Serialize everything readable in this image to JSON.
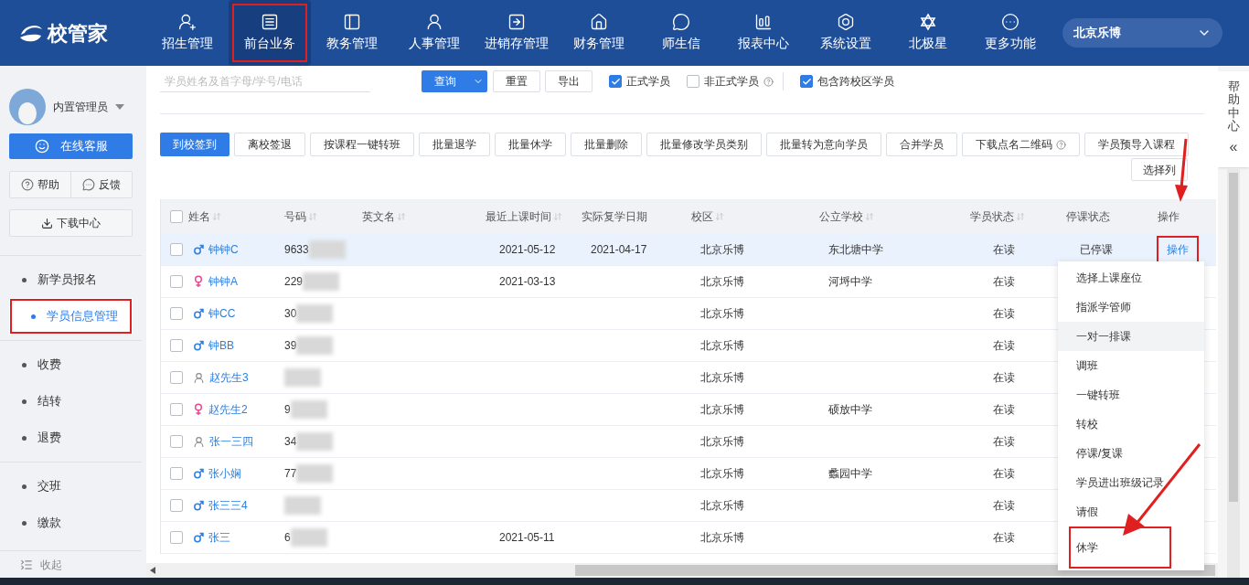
{
  "logo": {
    "text": "校管家"
  },
  "nav": [
    {
      "label": "招生管理",
      "selected": false,
      "highlighted": false
    },
    {
      "label": "前台业务",
      "selected": true,
      "highlighted": true
    },
    {
      "label": "教务管理",
      "selected": false,
      "highlighted": false
    },
    {
      "label": "人事管理",
      "selected": false,
      "highlighted": false
    },
    {
      "label": "进销存管理",
      "selected": false,
      "highlighted": false
    },
    {
      "label": "财务管理",
      "selected": false,
      "highlighted": false
    },
    {
      "label": "师生信",
      "selected": false,
      "highlighted": false
    },
    {
      "label": "报表中心",
      "selected": false,
      "highlighted": false
    },
    {
      "label": "系统设置",
      "selected": false,
      "highlighted": false
    },
    {
      "label": "北极星",
      "selected": false,
      "highlighted": false
    },
    {
      "label": "更多功能",
      "selected": false,
      "highlighted": false
    }
  ],
  "campus_select": {
    "value": "北京乐博"
  },
  "sidebar": {
    "user": "内置管理员",
    "service_button": "在线客服",
    "help": "帮助",
    "feedback": "反馈",
    "download": "下载中心",
    "menu_groups": [
      {
        "items": [
          {
            "label": "新学员报名",
            "selected": false,
            "highlighted": false
          },
          {
            "label": "学员信息管理",
            "selected": true,
            "highlighted": true
          }
        ]
      },
      {
        "items": [
          {
            "label": "收费",
            "selected": false,
            "highlighted": false
          },
          {
            "label": "结转",
            "selected": false,
            "highlighted": false
          },
          {
            "label": "退费",
            "selected": false,
            "highlighted": false
          }
        ]
      },
      {
        "items": [
          {
            "label": "交班",
            "selected": false,
            "highlighted": false
          },
          {
            "label": "缴款",
            "selected": false,
            "highlighted": false
          }
        ]
      }
    ],
    "collapse": "收起"
  },
  "filters": {
    "search": {
      "placeholder": "学员姓名及首字母/学号/电话"
    },
    "query_button": "查询",
    "reset_button": "重置",
    "export_button": "导出",
    "checks": [
      {
        "label": "正式学员",
        "checked": true,
        "help": false
      },
      {
        "label": "非正式学员",
        "checked": false,
        "help": true
      },
      {
        "label": "包含跨校区学员",
        "checked": true,
        "help": false
      }
    ]
  },
  "actions": [
    {
      "label": "到校签到",
      "primary": true,
      "help": false
    },
    {
      "label": "离校签退",
      "primary": false,
      "help": false
    },
    {
      "label": "按课程一键转班",
      "primary": false,
      "help": false
    },
    {
      "label": "批量退学",
      "primary": false,
      "help": false
    },
    {
      "label": "批量休学",
      "primary": false,
      "help": false
    },
    {
      "label": "批量删除",
      "primary": false,
      "help": false
    },
    {
      "label": "批量修改学员类别",
      "primary": false,
      "help": false
    },
    {
      "label": "批量转为意向学员",
      "primary": false,
      "help": false
    },
    {
      "label": "合并学员",
      "primary": false,
      "help": false
    },
    {
      "label": "下载点名二维码",
      "primary": false,
      "help": true
    },
    {
      "label": "学员预导入课程",
      "primary": false,
      "help": false
    }
  ],
  "choose_columns": "选择列",
  "table": {
    "all_checked": false,
    "columns": [
      {
        "label": "姓名",
        "sortable": true
      },
      {
        "label": "号码",
        "sortable": true
      },
      {
        "label": "英文名",
        "sortable": true
      },
      {
        "label": "最近上课时间",
        "sortable": true
      },
      {
        "label": "实际复学日期",
        "sortable": false
      },
      {
        "label": "校区",
        "sortable": true
      },
      {
        "label": "公立学校",
        "sortable": true
      },
      {
        "label": "学员状态",
        "sortable": true
      },
      {
        "label": "停课状态",
        "sortable": false
      },
      {
        "label": "操作",
        "sortable": false
      }
    ],
    "rows": [
      {
        "selected": true,
        "checked": false,
        "kind": "male",
        "name": "钟钟C",
        "number": "9633",
        "last_class": "2021-05-12",
        "resume_date": "2021-04-17",
        "campus": "北京乐博",
        "school": "东北塘中学",
        "status": "在读",
        "suspend": "已停课",
        "action": "操作"
      },
      {
        "selected": false,
        "checked": false,
        "kind": "female",
        "name": "钟钟A",
        "number": "229",
        "last_class": "2021-03-13",
        "campus": "北京乐博",
        "school": "河埒中学",
        "status": "在读"
      },
      {
        "selected": false,
        "checked": false,
        "kind": "male",
        "name": "钟CC",
        "number": "30",
        "campus": "北京乐博",
        "status": "在读"
      },
      {
        "selected": false,
        "checked": false,
        "kind": "male",
        "name": "钟BB",
        "number": "39",
        "campus": "北京乐博",
        "status": "在读"
      },
      {
        "selected": false,
        "checked": false,
        "kind": "unknown",
        "name": "赵先生3",
        "campus": "北京乐博",
        "status": "在读"
      },
      {
        "selected": false,
        "checked": false,
        "kind": "female",
        "name": "赵先生2",
        "number": "9",
        "campus": "北京乐博",
        "school": "硕放中学",
        "status": "在读"
      },
      {
        "selected": false,
        "checked": false,
        "kind": "unknown",
        "name": "张一三四",
        "number": "34",
        "campus": "北京乐博",
        "status": "在读"
      },
      {
        "selected": false,
        "checked": false,
        "kind": "male",
        "name": "张小娴",
        "number": "77",
        "campus": "北京乐博",
        "school": "蠡园中学",
        "status": "在读"
      },
      {
        "selected": false,
        "checked": false,
        "kind": "male",
        "name": "张三三4",
        "campus": "北京乐博",
        "status": "在读"
      },
      {
        "selected": false,
        "checked": false,
        "kind": "male",
        "name": "张三",
        "number": "6",
        "last_class": "2021-05-11",
        "campus": "北京乐博",
        "status": "在读"
      }
    ]
  },
  "action_menu": [
    {
      "label": "选择上课座位",
      "hovered": false,
      "highlighted": false
    },
    {
      "label": "指派学管师",
      "hovered": false,
      "highlighted": false
    },
    {
      "label": "一对一排课",
      "hovered": true,
      "highlighted": false
    },
    {
      "label": "调班",
      "hovered": false,
      "highlighted": false
    },
    {
      "label": "一键转班",
      "hovered": false,
      "highlighted": false
    },
    {
      "label": "转校",
      "hovered": false,
      "highlighted": false
    },
    {
      "label": "停课/复课",
      "hovered": false,
      "highlighted": false
    },
    {
      "label": "学员进出班级记录",
      "hovered": false,
      "highlighted": false
    },
    {
      "label": "请假",
      "hovered": false,
      "highlighted": false
    },
    {
      "label": "休学",
      "hovered": false,
      "highlighted": true
    }
  ],
  "help_center": {
    "label": "帮助中心",
    "arrow": "«"
  }
}
